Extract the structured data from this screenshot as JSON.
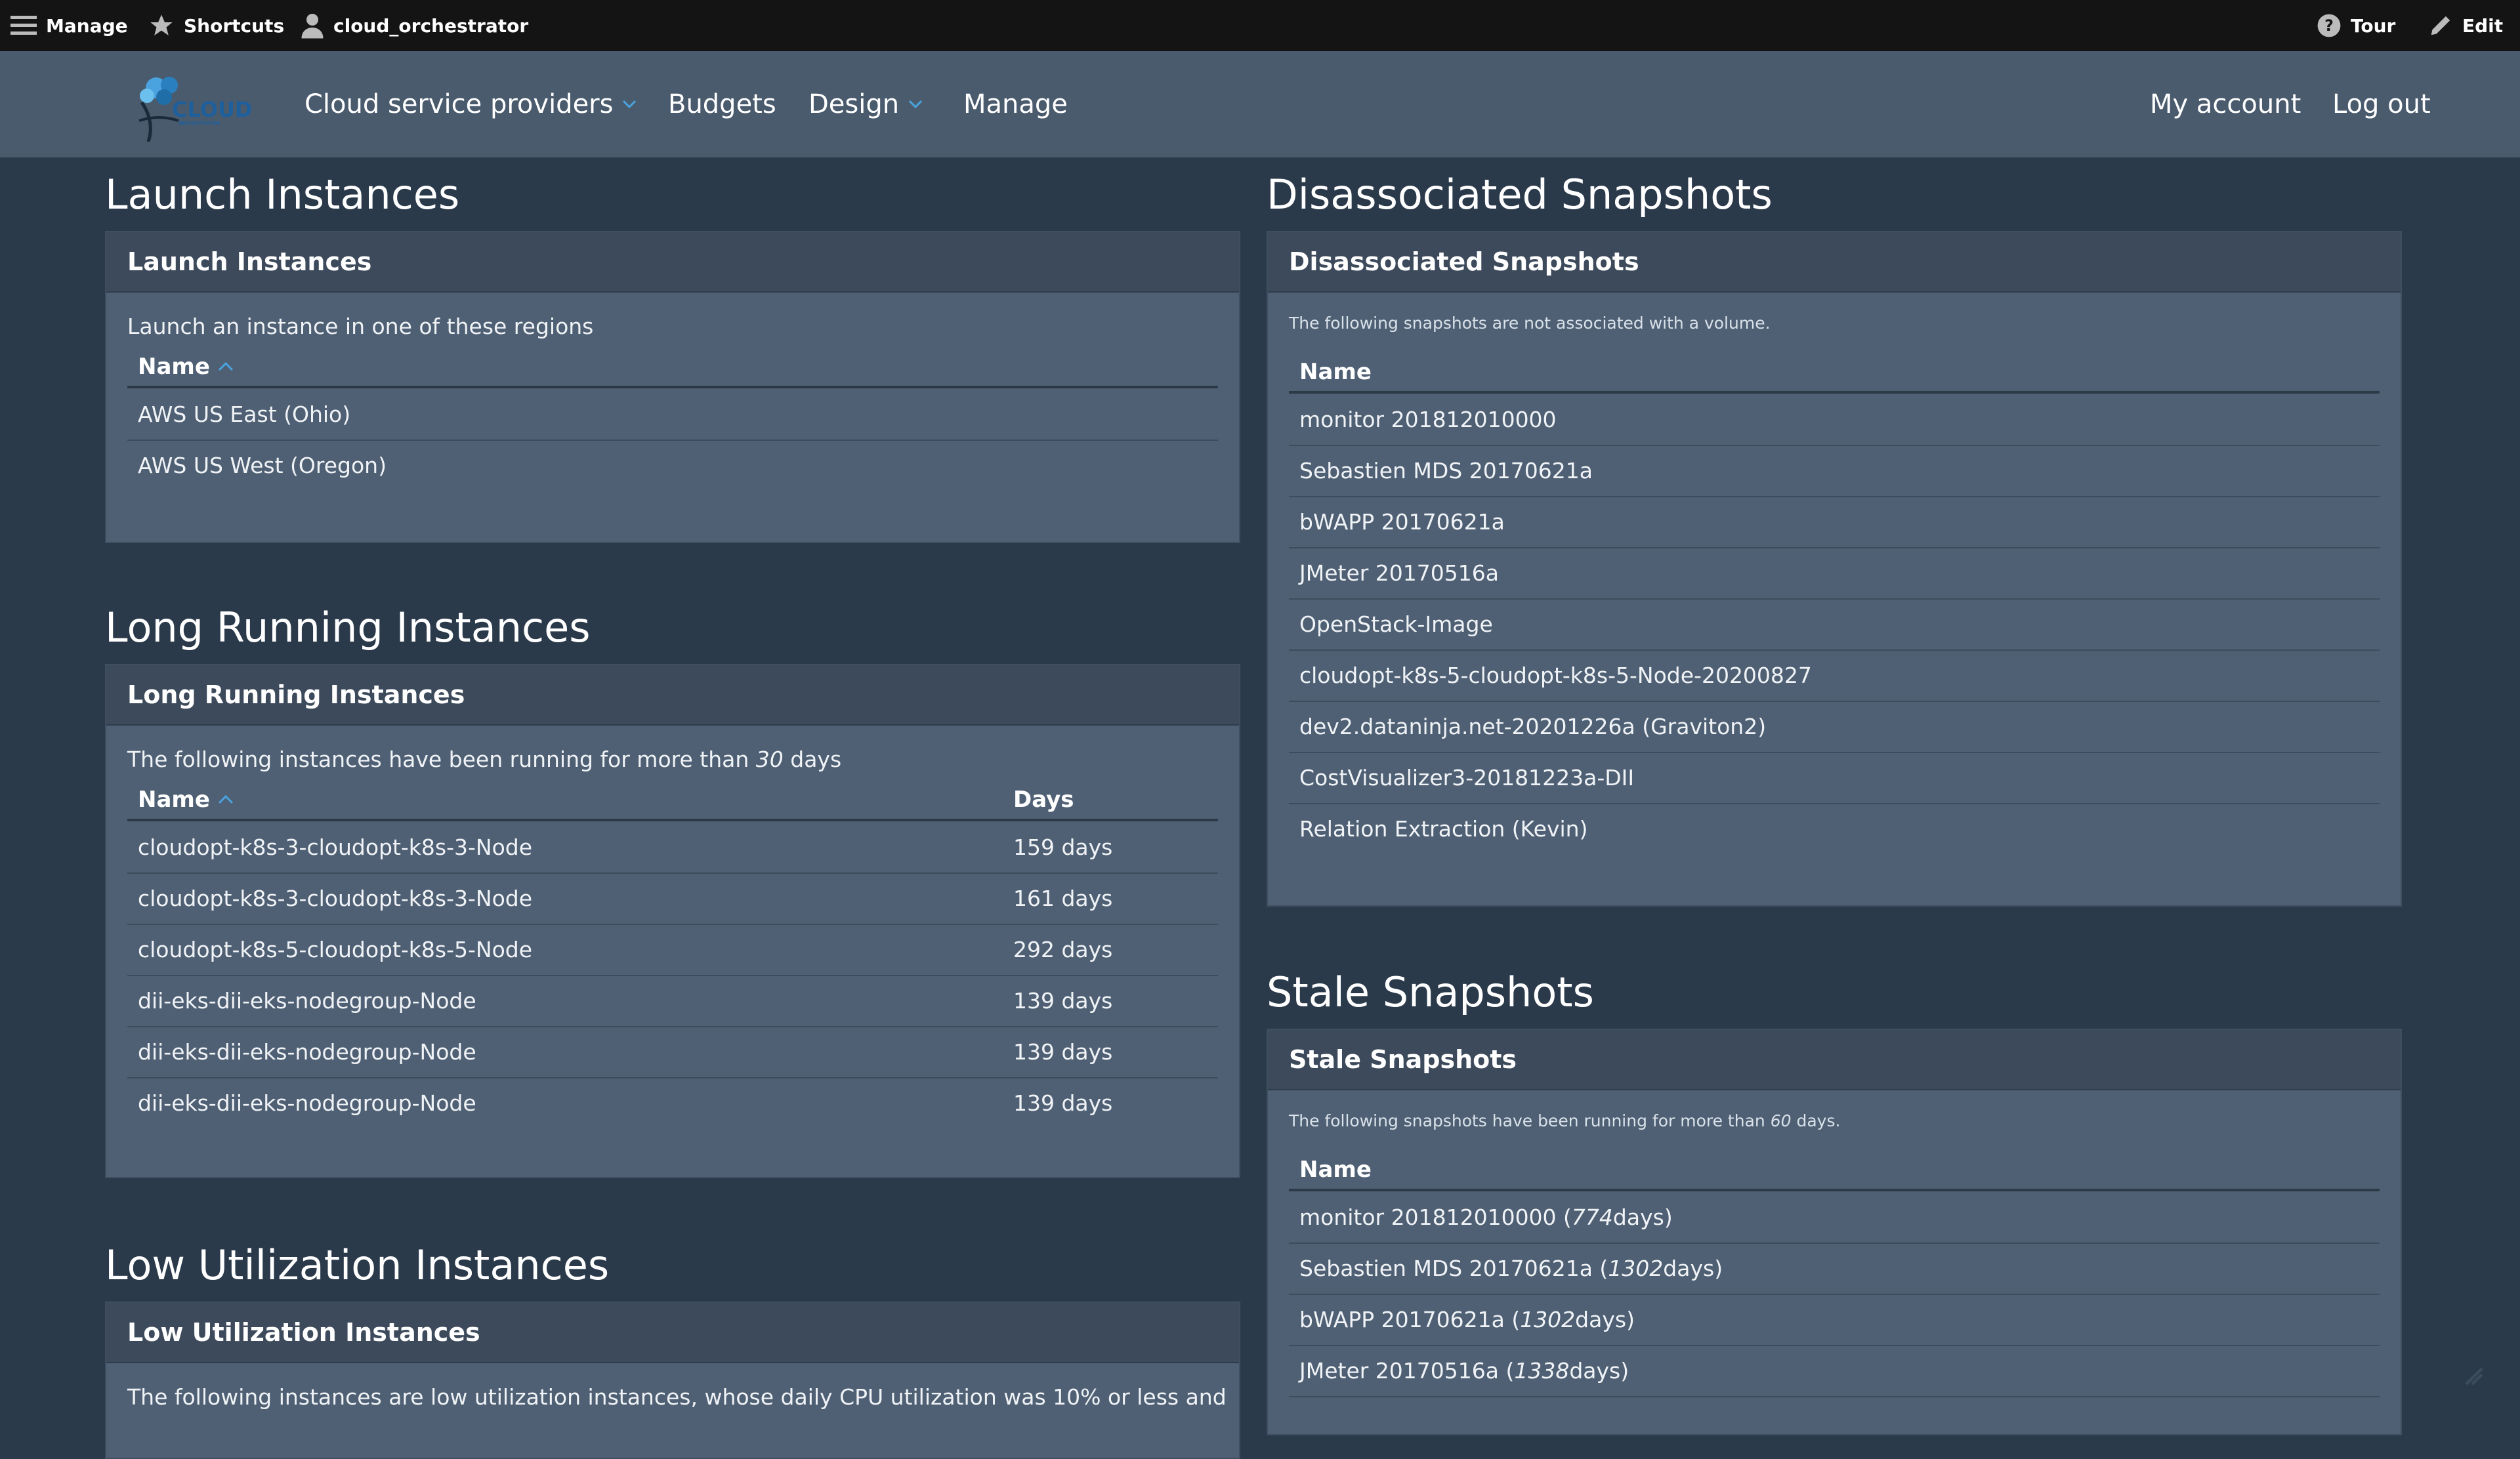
{
  "toolbar": {
    "manage": "Manage",
    "shortcuts": "Shortcuts",
    "user": "cloud_orchestrator",
    "tour": "Tour",
    "edit": "Edit"
  },
  "logo": {
    "text": "CLOUD",
    "subtext": "ORCHESTRATOR"
  },
  "nav": {
    "providers": "Cloud service providers",
    "budgets": "Budgets",
    "design": "Design",
    "manage": "Manage",
    "account": "My account",
    "logout": "Log out"
  },
  "launch": {
    "heading": "Launch Instances",
    "panel_title": "Launch Instances",
    "description": "Launch an instance in one of these regions",
    "col_name": "Name",
    "rows": [
      "AWS US East (Ohio)",
      "AWS US West (Oregon)"
    ]
  },
  "long_running": {
    "heading": "Long Running Instances",
    "panel_title": "Long Running Instances",
    "desc_prefix": "The following instances have been running for more than ",
    "desc_days": "30",
    "desc_suffix": " days",
    "col_name": "Name",
    "col_days": "Days",
    "rows": [
      {
        "name": "cloudopt-k8s-3-cloudopt-k8s-3-Node",
        "days": "159 days"
      },
      {
        "name": "cloudopt-k8s-3-cloudopt-k8s-3-Node",
        "days": "161 days"
      },
      {
        "name": "cloudopt-k8s-5-cloudopt-k8s-5-Node",
        "days": "292 days"
      },
      {
        "name": "dii-eks-dii-eks-nodegroup-Node",
        "days": "139 days"
      },
      {
        "name": "dii-eks-dii-eks-nodegroup-Node",
        "days": "139 days"
      },
      {
        "name": "dii-eks-dii-eks-nodegroup-Node",
        "days": "139 days"
      }
    ]
  },
  "low_util": {
    "heading": "Low Utilization Instances",
    "panel_title": "Low Utilization Instances",
    "description": "The following instances are low utilization instances, whose daily CPU utilization was 10% or less and"
  },
  "disassociated": {
    "heading": "Disassociated Snapshots",
    "panel_title": "Disassociated Snapshots",
    "description": "The following snapshots are not associated with a volume.",
    "col_name": "Name",
    "rows": [
      "monitor 201812010000",
      "Sebastien MDS 20170621a",
      "bWAPP 20170621a",
      "JMeter 20170516a",
      "OpenStack-Image",
      "cloudopt-k8s-5-cloudopt-k8s-5-Node-20200827",
      "dev2.dataninja.net-20201226a (Graviton2)",
      "CostVisualizer3-20181223a-DII",
      "Relation Extraction (Kevin)"
    ]
  },
  "stale": {
    "heading": "Stale Snapshots",
    "panel_title": "Stale Snapshots",
    "desc_prefix": "The following snapshots have been running for more than ",
    "desc_days": "60",
    "desc_suffix": " days.",
    "col_name": "Name",
    "rows": [
      {
        "name": "monitor 201812010000 (",
        "days": "774",
        "suffix": " days)"
      },
      {
        "name": "Sebastien MDS 20170621a (",
        "days": "1302",
        "suffix": " days)"
      },
      {
        "name": "bWAPP 20170621a (",
        "days": "1302",
        "suffix": " days)"
      },
      {
        "name": "JMeter 20170516a (",
        "days": "1338",
        "suffix": " days)"
      }
    ]
  },
  "colors": {
    "background": "#2b3a4b",
    "navbar": "#4a5b6e",
    "toolbar": "#141414",
    "panel": "#4f6074",
    "panel_header": "#3c4a5b",
    "accent": "#4aa3df"
  }
}
